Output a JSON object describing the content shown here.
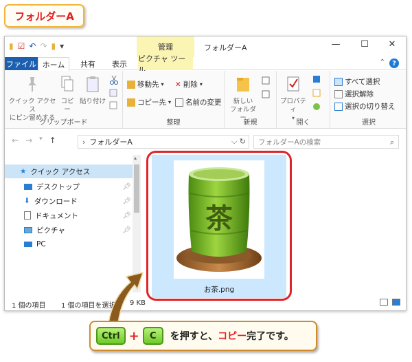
{
  "label": {
    "title": "フォルダーA"
  },
  "window": {
    "title": "フォルダーA",
    "manage_tab": "管理",
    "tabs": {
      "file": "ファイル",
      "home": "ホーム",
      "share": "共有",
      "view": "表示",
      "picture_tools": "ピクチャ ツール"
    },
    "controls": {
      "minimize": "—",
      "maximize": "☐",
      "close": "✕"
    }
  },
  "ribbon": {
    "clipboard": {
      "label": "クリップボード",
      "pin_quick_access": [
        "クイック アクセス",
        "にピン留めする"
      ],
      "copy": "コピー",
      "paste": "貼り付け"
    },
    "organize": {
      "label": "整理",
      "move_to": "移動先",
      "copy_to": "コピー先",
      "delete": "削除",
      "rename": "名前の変更"
    },
    "new": {
      "label": "新規",
      "new_folder": [
        "新しい",
        "フォルダー"
      ]
    },
    "open": {
      "label": "開く",
      "properties": "プロパティ"
    },
    "select": {
      "label": "選択",
      "select_all": "すべて選択",
      "select_none": "選択解除",
      "invert": "選択の切り替え"
    }
  },
  "address": {
    "path": "フォルダーA",
    "search_placeholder": "フォルダーAの検索"
  },
  "nav": {
    "quick_access": "クイック アクセス",
    "items": [
      "デスクトップ",
      "ダウンロード",
      "ドキュメント",
      "ピクチャ",
      "PC"
    ]
  },
  "file": {
    "name": "お茶.png",
    "glyph": "茶"
  },
  "status": {
    "count": "1 個の項目",
    "selected": "1 個の項目を選択",
    "size": "9 KB"
  },
  "callout": {
    "key1": "Ctrl",
    "plus": "+",
    "key2": "C",
    "text_before": "を押すと、",
    "text_red": "コピー",
    "text_after": "完了です。"
  },
  "colors": {
    "accent_red": "#e0242a",
    "file_tab": "#1c5fb0",
    "selection": "#cce8ff",
    "key_green": "#6fc92a"
  }
}
